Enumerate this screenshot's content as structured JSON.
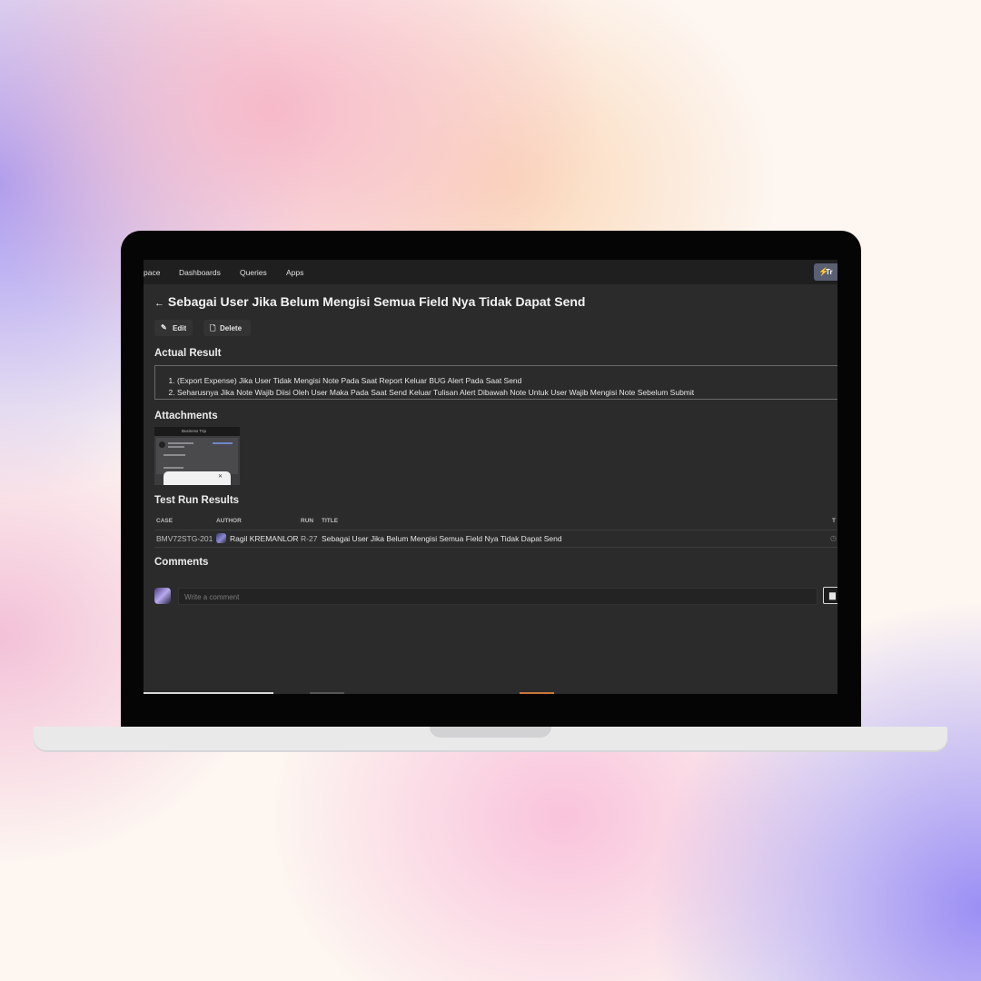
{
  "nav": {
    "items": [
      "pace",
      "Dashboards",
      "Queries",
      "Apps"
    ],
    "pill_label": "Tr"
  },
  "issue": {
    "back_arrow": "←",
    "title": "Sebagai User Jika Belum Mengisi Semua Field Nya Tidak Dapat Send",
    "edit_label": "Edit",
    "delete_label": "Delete"
  },
  "actual_result": {
    "heading": "Actual Result",
    "items": [
      "(Export Expense) Jika User Tidak Mengisi Note Pada Saat Report Keluar BUG Alert Pada Saat Send",
      "Seharusnya Jika Note Wajib Diisi Oleh User Maka Pada Saat Send Keluar Tulisan Alert Dibawah Note Untuk User Wajib Mengisi Note Sebelum Submit"
    ]
  },
  "attachments": {
    "heading": "Attachments",
    "thumb_title": "Business Trip"
  },
  "test_run": {
    "heading": "Test Run Results",
    "columns": [
      "CASE",
      "AUTHOR",
      "RUN",
      "TITLE",
      "T"
    ],
    "rows": [
      {
        "case": "BMV72STG-201",
        "author": "Ragil KREMANLOR",
        "run": "R-27",
        "title": "Sebagai User Jika Belum Mengisi Semua Field Nya Tidak Dapat Send"
      }
    ]
  },
  "comments": {
    "heading": "Comments",
    "placeholder": "Write a comment"
  },
  "colors": {
    "screen_bg": "#2b2b2c",
    "nav_bg": "#1f1f20",
    "accent_pill": "#5a5f72"
  },
  "icons": [
    "back-arrow-icon",
    "pencil-icon",
    "trash-icon",
    "image-icon",
    "clock-icon"
  ]
}
